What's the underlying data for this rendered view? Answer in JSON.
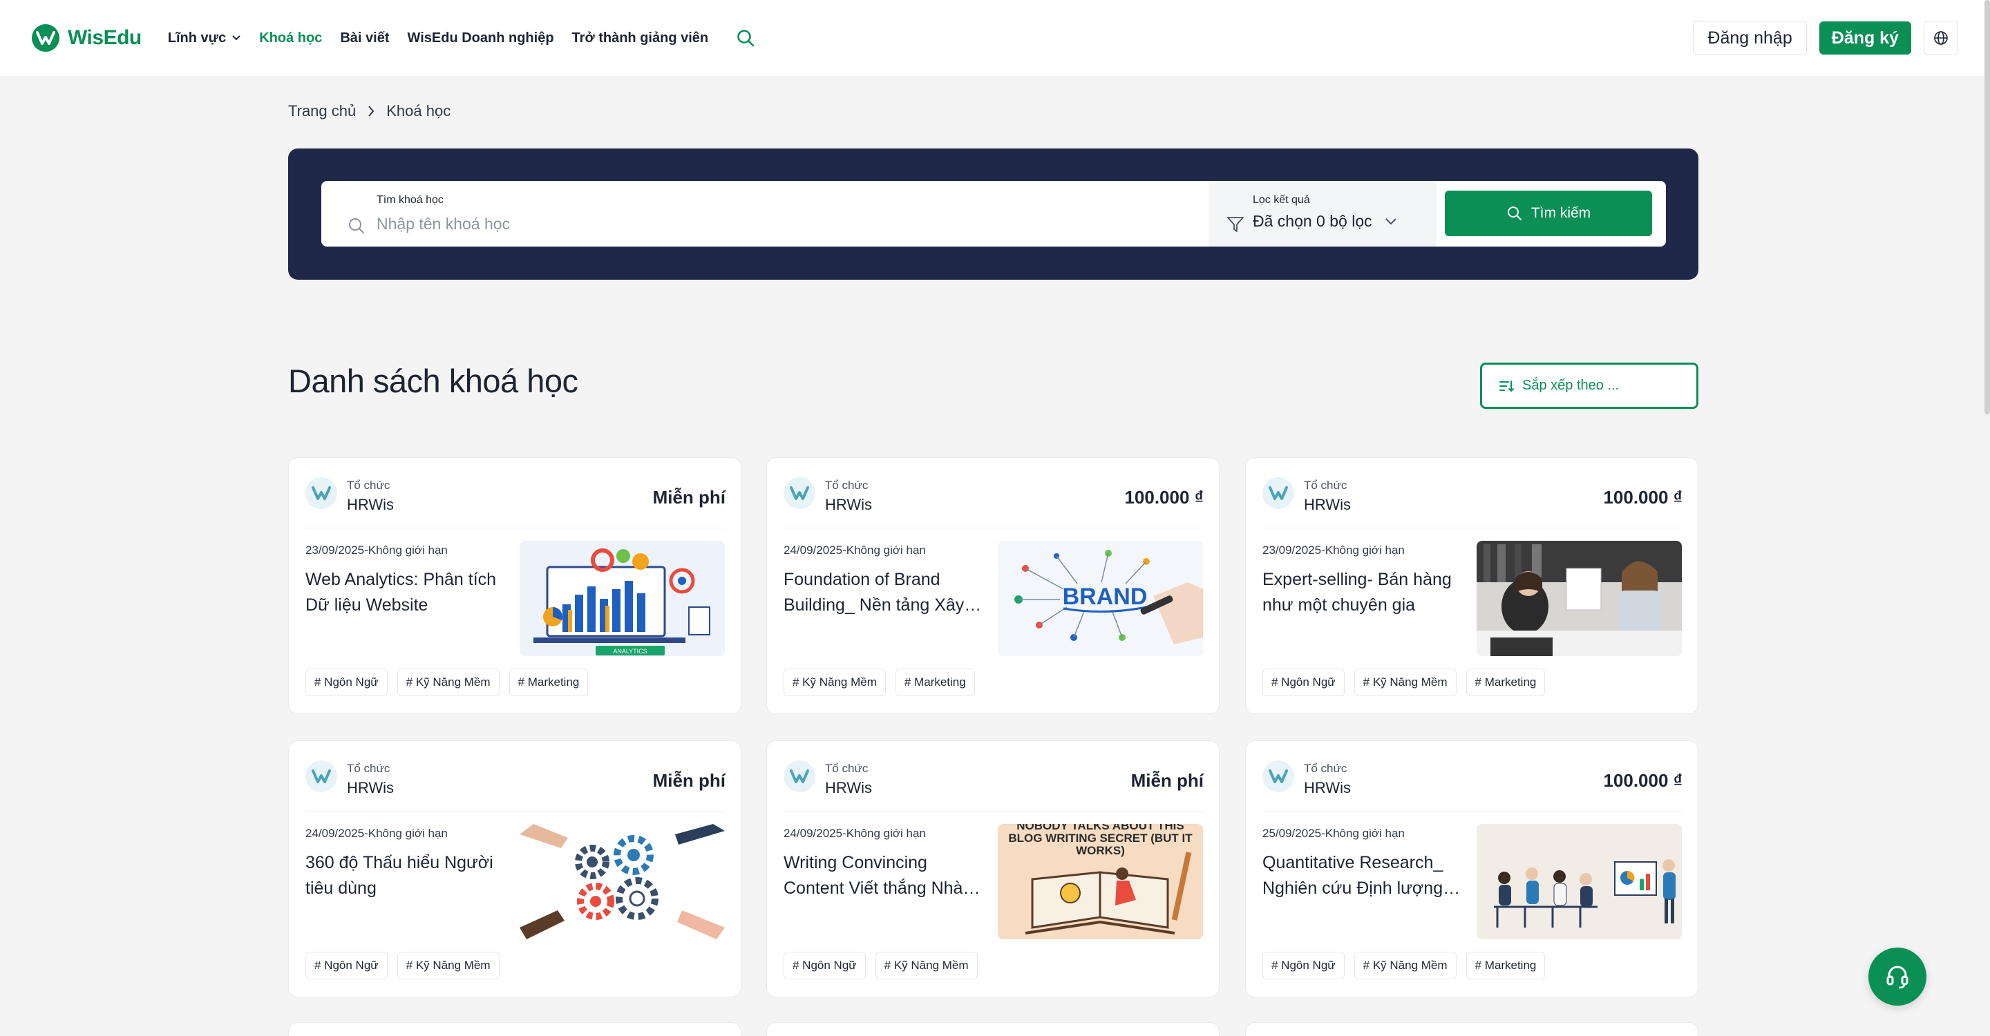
{
  "brand": {
    "name": "WisEdu",
    "color": "#0a8f55",
    "dark_panel": "#20284a"
  },
  "nav": {
    "items": [
      {
        "label": "Lĩnh vực",
        "has_dropdown": true
      },
      {
        "label": "Khoá học",
        "active": true
      },
      {
        "label": "Bài viết"
      },
      {
        "label": "WisEdu Doanh nghiệp"
      },
      {
        "label": "Trở thành giảng viên"
      }
    ],
    "search_icon": "search-icon"
  },
  "auth": {
    "login_label": "Đăng nhập",
    "register_label": "Đăng ký",
    "language_icon": "globe-icon"
  },
  "breadcrumb": {
    "home": "Trang chủ",
    "current": "Khoá học"
  },
  "search": {
    "label": "Tìm khoá học",
    "placeholder": "Nhập tên khoá học",
    "value": "",
    "filter_label": "Lọc kết quả",
    "filter_value": "Đã chọn 0 bộ lọc",
    "button_label": "Tìm kiếm"
  },
  "list": {
    "title": "Danh sách khoá học",
    "sort_label": "Sắp xếp theo ..."
  },
  "courses": [
    {
      "org_label": "Tổ chức",
      "org": "HRWis",
      "price": "Miễn phí",
      "date": "23/09/2025-Không giới hạn",
      "title": "Web Analytics: Phân tích Dữ liệu Website",
      "tags": [
        "# Ngôn Ngữ",
        "# Kỹ Năng Mềm",
        "# Marketing"
      ],
      "thumb": "analytics",
      "thumb_text": "ANALYTICS"
    },
    {
      "org_label": "Tổ chức",
      "org": "HRWis",
      "price": "100.000 ₫",
      "date": "24/09/2025-Không giới hạn",
      "title": "Foundation of Brand Building_ Nền tảng Xây dựng Thương hiệu",
      "tags": [
        "# Kỹ Năng Mềm",
        "# Marketing"
      ],
      "thumb": "brand",
      "thumb_text": "BRAND"
    },
    {
      "org_label": "Tổ chức",
      "org": "HRWis",
      "price": "100.000 ₫",
      "date": "23/09/2025-Không giới hạn",
      "title": "Expert-selling- Bán hàng như một chuyên gia",
      "tags": [
        "# Ngôn Ngữ",
        "# Kỹ Năng Mềm",
        "# Marketing"
      ],
      "thumb": "selling",
      "thumb_text": ""
    },
    {
      "org_label": "Tổ chức",
      "org": "HRWis",
      "price": "Miễn phí",
      "date": "24/09/2025-Không giới hạn",
      "title": "360 độ Thấu hiểu Người tiêu dùng",
      "tags": [
        "# Ngôn Ngữ",
        "# Kỹ Năng Mềm"
      ],
      "thumb": "gears",
      "thumb_text": ""
    },
    {
      "org_label": "Tổ chức",
      "org": "HRWis",
      "price": "Miễn phí",
      "date": "24/09/2025-Không giới hạn",
      "title": "Writing Convincing Content Viết thắng Nhà tuyển dụng",
      "tags": [
        "# Ngôn Ngữ",
        "# Kỹ Năng Mềm"
      ],
      "thumb": "blog",
      "thumb_text": "NOBODY TALKS ABOUT THIS BLOG WRITING SECRET (BUT IT WORKS)"
    },
    {
      "org_label": "Tổ chức",
      "org": "HRWis",
      "price": "100.000 ₫",
      "date": "25/09/2025-Không giới hạn",
      "title": "Quantitative Research_ Nghiên cứu Định lượng trong Marketing",
      "tags": [
        "# Ngôn Ngữ",
        "# Kỹ Năng Mềm",
        "# Marketing"
      ],
      "thumb": "research",
      "thumb_text": ""
    }
  ],
  "support_icon": "headset-icon"
}
